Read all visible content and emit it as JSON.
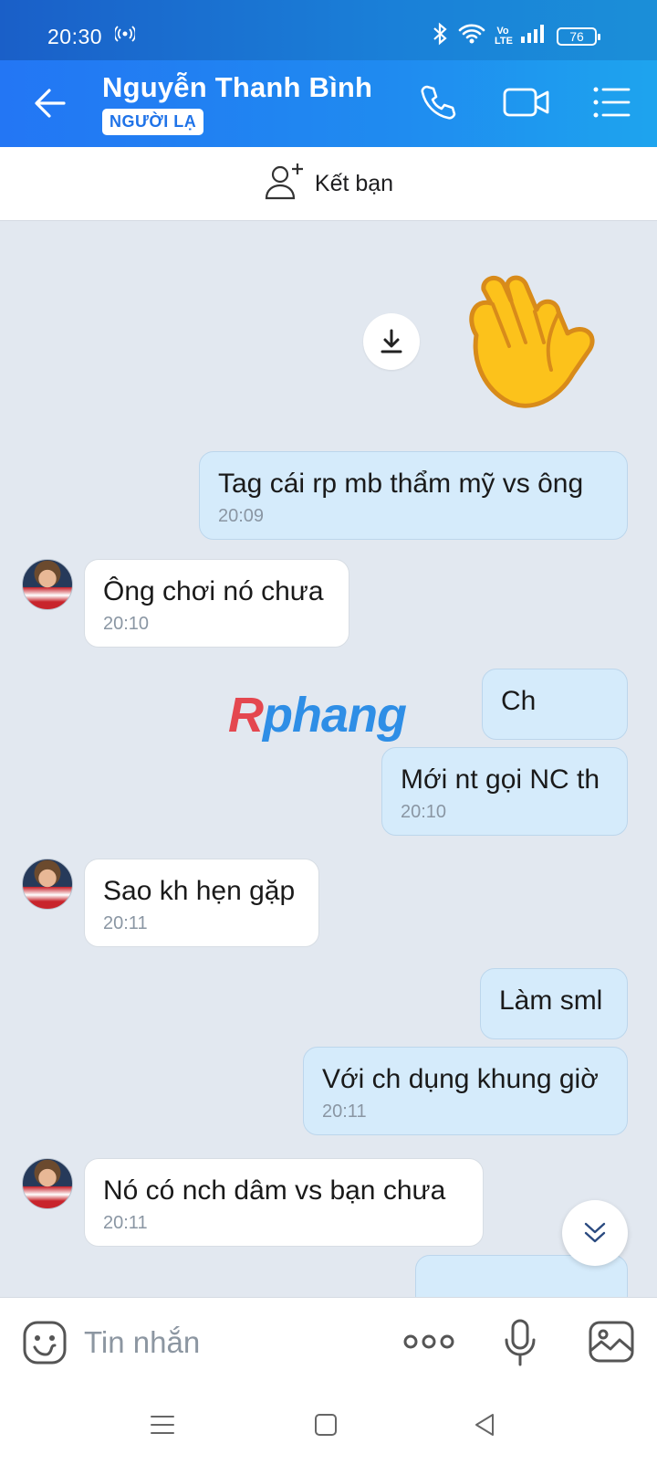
{
  "status_bar": {
    "time": "20:30",
    "network_label": "Vo LTE",
    "battery": "76",
    "icons": [
      "hotspot-icon",
      "bluetooth-icon",
      "wifi-icon",
      "volte-icon",
      "signal-icon",
      "battery-icon"
    ]
  },
  "header": {
    "contact_name": "Nguyễn Thanh Bình",
    "badge": "NGƯỜI LẠ",
    "icons": [
      "back-arrow-icon",
      "phone-icon",
      "video-call-icon",
      "menu-icon"
    ]
  },
  "friend_bar": {
    "label": "Kết bạn",
    "icon": "add-friend-icon"
  },
  "watermark": {
    "first_letter": "R",
    "rest": "phang"
  },
  "messages": [
    {
      "direction": "out",
      "type": "sticker",
      "sticker": "waving-hand"
    },
    {
      "direction": "out",
      "text": "Tag cái rp mb thẩm mỹ vs ông",
      "time": "20:09"
    },
    {
      "direction": "in",
      "text": "Ông chơi nó chưa",
      "time": "20:10"
    },
    {
      "direction": "out",
      "text": "Ch",
      "time": ""
    },
    {
      "direction": "out",
      "text": "Mới nt gọi NC th",
      "time": "20:10"
    },
    {
      "direction": "in",
      "text": "Sao kh hẹn gặp",
      "time": "20:11"
    },
    {
      "direction": "out",
      "text": "Làm sml",
      "time": ""
    },
    {
      "direction": "out",
      "text": "Với ch dụng khung giờ",
      "time": "20:11"
    },
    {
      "direction": "in",
      "text": "Nó có nch dâm vs bạn chưa",
      "time": "20:11"
    }
  ],
  "input_bar": {
    "placeholder": "Tin nhắn",
    "icons": [
      "emoji-icon",
      "more-icon",
      "microphone-icon",
      "image-icon"
    ]
  },
  "colors": {
    "header_start": "#2376f4",
    "header_end": "#1ea4ee",
    "outgoing_bubble": "#d5ebfb",
    "incoming_bubble": "#ffffff",
    "chat_background": "#e2e8f0"
  }
}
